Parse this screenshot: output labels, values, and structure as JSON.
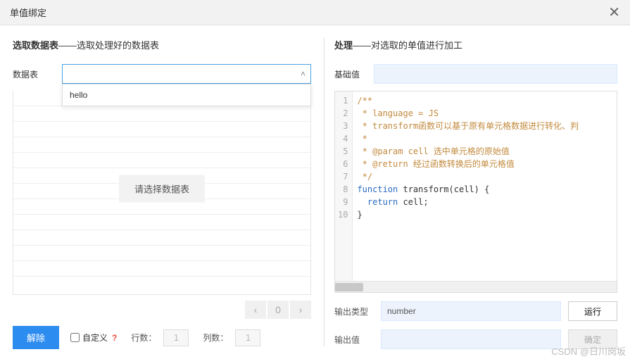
{
  "header": {
    "title": "单值绑定"
  },
  "left": {
    "section_bold": "选取数据表",
    "section_desc": "——选取处理好的数据表",
    "datatable_label": "数据表",
    "dropdown_items": [
      "hello"
    ],
    "table_placeholder": "请选择数据表",
    "pager": {
      "prev": "‹",
      "page": "0",
      "next": "›"
    },
    "release_btn": "解除",
    "custom_label": "自定义",
    "qmark": "?",
    "rows_label": "行数：",
    "rows_value": "1",
    "cols_label": "列数：",
    "cols_value": "1"
  },
  "right": {
    "section_bold": "处理",
    "section_desc": "——对选取的单值进行加工",
    "base_label": "基础值",
    "code": {
      "lines": [
        {
          "n": "1",
          "t": "comment",
          "text": "/**"
        },
        {
          "n": "2",
          "t": "comment",
          "text": " * language = JS"
        },
        {
          "n": "3",
          "t": "comment",
          "text": " * transform函数可以基于原有单元格数据进行转化、判"
        },
        {
          "n": "4",
          "t": "comment",
          "text": " *"
        },
        {
          "n": "5",
          "t": "comment",
          "text": " * @param cell 选中单元格的原始值"
        },
        {
          "n": "6",
          "t": "comment",
          "text": " * @return 经过函数转换后的单元格值"
        },
        {
          "n": "7",
          "t": "comment",
          "text": " */"
        },
        {
          "n": "8",
          "t": "code",
          "html": "<span class=\"tok-kw\">function</span> <span class=\"tok-fn\">transform</span>(<span class=\"tok-id\">cell</span>) {"
        },
        {
          "n": "9",
          "t": "code",
          "html": "  <span class=\"tok-kw\">return</span> <span class=\"tok-id\">cell</span>;"
        },
        {
          "n": "10",
          "t": "code",
          "html": "}"
        }
      ]
    },
    "out_type_label": "输出类型",
    "out_type_value": "number",
    "run_btn": "运行",
    "out_val_label": "输出值",
    "ok_btn": "确定"
  },
  "watermark": "CSDN @日川岗坂"
}
